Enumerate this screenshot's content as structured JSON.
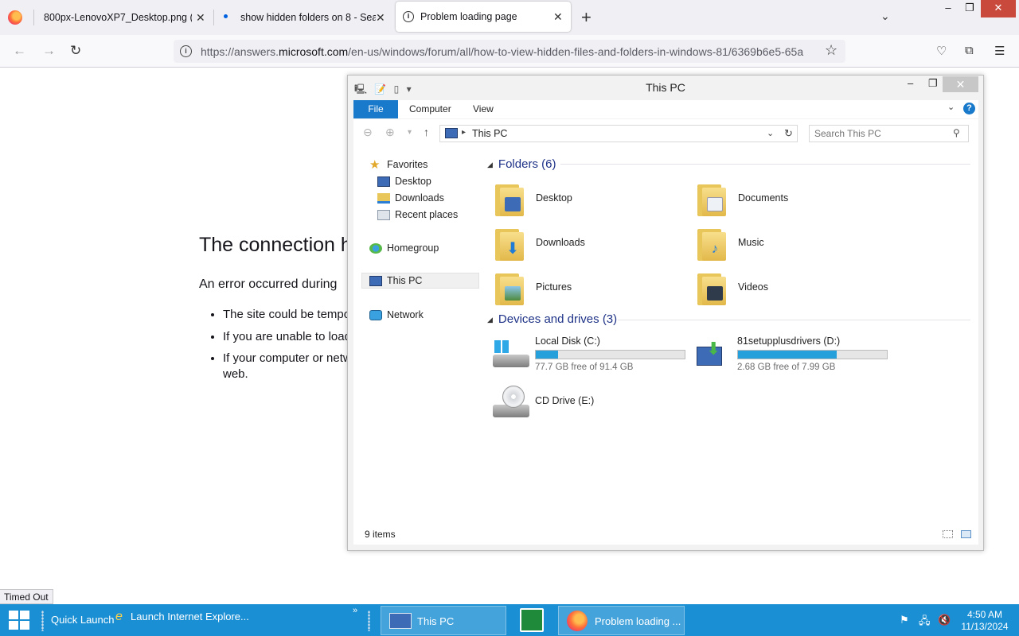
{
  "browser": {
    "tabs": [
      {
        "label": "800px-LenovoXP7_Desktop.png (WE"
      },
      {
        "label": "show hidden folders on 8 - Sear"
      },
      {
        "label": "Problem loading page"
      }
    ],
    "url_prefix": "https://answers.",
    "url_domain": "microsoft.com",
    "url_suffix": "/en-us/windows/forum/all/how-to-view-hidden-files-and-folders-in-windows-81/6369b6e5-65a",
    "status_tooltip": "Timed Out"
  },
  "error_page": {
    "title": "The connection h",
    "description": "An error occurred during",
    "bullets": [
      "The site could be tempo",
      "If you are unable to load",
      "If your computer or netw"
    ],
    "bullet3_cont": "web."
  },
  "explorer": {
    "title": "This PC",
    "ribbon_tabs": [
      "File",
      "Computer",
      "View"
    ],
    "address": "This PC",
    "search_placeholder": "Search This PC",
    "nav": {
      "favorites": "Favorites",
      "desktop": "Desktop",
      "downloads": "Downloads",
      "recent": "Recent places",
      "homegroup": "Homegroup",
      "thispc": "This PC",
      "network": "Network"
    },
    "folders_header": "Folders (6)",
    "folders": [
      "Desktop",
      "Documents",
      "Downloads",
      "Music",
      "Pictures",
      "Videos"
    ],
    "drives_header": "Devices and drives (3)",
    "drives": [
      {
        "name": "Local Disk (C:)",
        "free": "77.7 GB free of 91.4 GB",
        "used_fraction": 0.15
      },
      {
        "name": "81setupplusdrivers (D:)",
        "free": "2.68 GB free of 7.99 GB",
        "used_fraction": 0.665
      },
      {
        "name": "CD Drive (E:)"
      }
    ],
    "item_count": "9 items"
  },
  "taskbar": {
    "quick_launch": "Quick Launch",
    "ie_launch": "Launch Internet Explore...",
    "chevron": "»",
    "task_thispc": "This PC",
    "task_firefox": "Problem loading ...",
    "time": "4:50 AM",
    "date": "11/13/2024"
  },
  "colors": {
    "taskbar": "#1b8fd3",
    "ribbon_file": "#1979ca",
    "progress_fill": "#26a0da"
  }
}
